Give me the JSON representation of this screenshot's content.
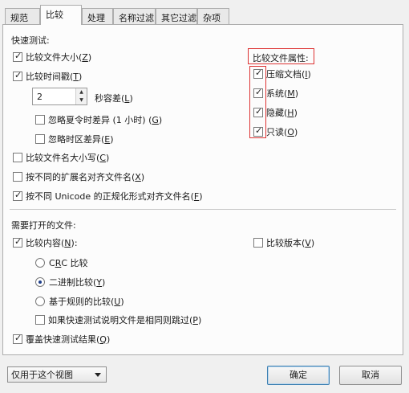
{
  "tabs": [
    {
      "label": "规范"
    },
    {
      "label": "比较",
      "active": true
    },
    {
      "label": "处理"
    },
    {
      "label": "名称过滤"
    },
    {
      "label": "其它过滤"
    },
    {
      "label": "杂项"
    }
  ],
  "quick_test": {
    "heading": "快速测试:",
    "compare_size": {
      "text": "比较文件大小(",
      "key": "Z",
      "end": ")",
      "checked": true
    },
    "compare_timestamp": {
      "text": "比较时间戳(",
      "key": "T",
      "end": ")",
      "checked": true
    },
    "tolerance_value": "2",
    "tolerance_label": {
      "text": "秒容差(",
      "key": "L",
      "end": ")"
    },
    "ignore_dst": {
      "text": "忽略夏令时差异 (1 小时) (",
      "key": "G",
      "end": ")",
      "checked": false
    },
    "ignore_tz": {
      "text": "忽略时区差异(",
      "key": "E",
      "end": ")",
      "checked": false
    },
    "compare_name_case": {
      "text": "比较文件名大小写(",
      "key": "C",
      "end": ")",
      "checked": false
    },
    "align_ext": {
      "text": "按不同的扩展名对齐文件名(",
      "key": "X",
      "end": ")",
      "checked": false
    },
    "align_unicode": {
      "text": "按不同 Unicode 的正规化形式对齐文件名(",
      "key": "F",
      "end": ")",
      "checked": true
    }
  },
  "attributes": {
    "heading": "比较文件属性:",
    "archive": {
      "text": "压缩文档(",
      "key": "I",
      "end": ")",
      "checked": true
    },
    "system": {
      "text": "系统(",
      "key": "M",
      "end": ")",
      "checked": true
    },
    "hidden": {
      "text": "隐藏(",
      "key": "H",
      "end": ")",
      "checked": true
    },
    "readonly": {
      "text": "只读(",
      "key": "O",
      "end": ")",
      "checked": true
    }
  },
  "open_files": {
    "heading": "需要打开的文件:",
    "compare_content": {
      "text": "比较内容(",
      "key": "N",
      "end": "):",
      "checked": true
    },
    "compare_version": {
      "text": "比较版本(",
      "key": "V",
      "end": ")",
      "checked": false
    },
    "crc": {
      "pre": "C",
      "key": "R",
      "post": "C 比较",
      "checked": false
    },
    "binary": {
      "text": "二进制比较(",
      "key": "Y",
      "end": ")",
      "checked": true
    },
    "rules": {
      "text": "基于规则的比较(",
      "key": "U",
      "end": ")",
      "checked": false
    },
    "skip_if_same": {
      "text": "如果快速测试说明文件是相同则跳过(",
      "key": "P",
      "end": ")",
      "checked": false
    },
    "override": {
      "text": "覆盖快速测试结果(",
      "key": "Q",
      "end": ")",
      "checked": true
    }
  },
  "footer": {
    "scope_select": "仅用于这个视图",
    "ok_label": "确定",
    "cancel_label": "取消"
  },
  "colors": {
    "highlight_red": "#d33333",
    "accent_blue": "#3c7fb1"
  }
}
